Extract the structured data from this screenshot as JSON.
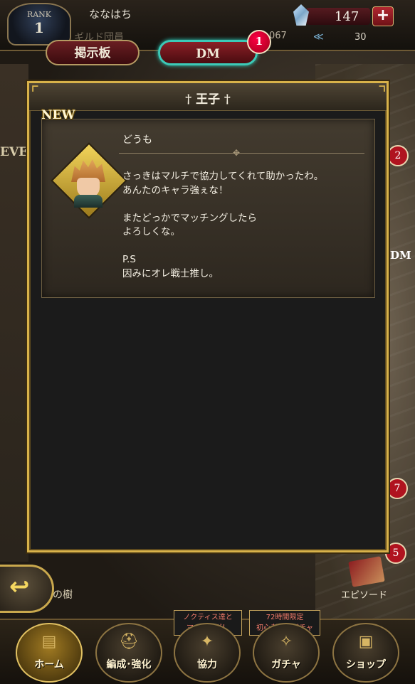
{
  "header": {
    "rank_label": "RANK",
    "rank_value": "1",
    "player_name": "ななはち",
    "guild_role": "ギルド団員",
    "exp_partial": "067",
    "gem_count": "147",
    "plus_label": "+",
    "stamina_value": "30"
  },
  "tabs": {
    "board_label": "掲示板",
    "dm_label": "DM",
    "dm_badge": "1"
  },
  "background": {
    "ev_label": "EVE",
    "side_count_1": "2",
    "side_count_2": "7",
    "side_count_3": "5",
    "side_dm_label": "DM",
    "tree_label": "の樹",
    "episode_label": "エピソード"
  },
  "modal": {
    "title": "† 王子 †",
    "new_tag": "NEW",
    "message": {
      "subject": "どうも",
      "body": "さっきはマルチで協力してくれて助かったわ。\nあんたのキャラ強ぇな！\n\nまたどっかでマッチングしたら\nよろしくな。\n\nP.S\n因みにオレ戦士推し。"
    }
  },
  "back_button": {
    "icon": "back-arrow-icon"
  },
  "bottom_nav": {
    "items": [
      {
        "label": "ホーム",
        "icon": "home-map-icon",
        "active": true
      },
      {
        "label": "編成･強化",
        "icon": "helmet-icon",
        "active": false
      },
      {
        "label": "協力",
        "icon": "cooperation-icon",
        "active": false
      },
      {
        "label": "ガチャ",
        "icon": "gacha-icon",
        "active": false
      },
      {
        "label": "ショップ",
        "icon": "shop-icon",
        "active": false
      }
    ],
    "promo_coop": "ノクティス達と\nマッチング！",
    "promo_gacha": "72時間限定\n初心者応援ガチャ"
  },
  "colors": {
    "modal_border": "#d8b24a",
    "dm_tab_border": "#3cc9b7",
    "badge_red": "#b0131f"
  }
}
